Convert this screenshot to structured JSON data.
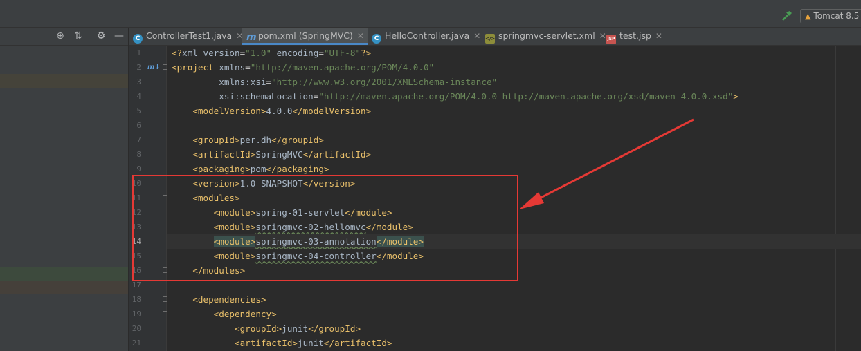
{
  "toolbar": {
    "build_icon": "hammer-icon",
    "run_config_label": "Tomcat 8.5"
  },
  "left_panel": {
    "icons": [
      "crosshair-icon",
      "collapse-icon",
      "gear-icon",
      "minimize-icon"
    ]
  },
  "tabs": [
    {
      "label": "ControllerTest1.java",
      "icon": "class-icon",
      "active": false
    },
    {
      "label": "pom.xml (SpringMVC)",
      "icon": "maven-icon",
      "active": true
    },
    {
      "label": "HelloController.java",
      "icon": "class-icon",
      "active": false
    },
    {
      "label": "springmvc-servlet.xml",
      "icon": "xml-icon",
      "active": false
    },
    {
      "label": "test.jsp",
      "icon": "jsp-icon",
      "active": false
    }
  ],
  "editor": {
    "current_line": 14,
    "lines": [
      {
        "n": "1",
        "text": "<?xml version=\"1.0\" encoding=\"UTF-8\"?>"
      },
      {
        "n": "2",
        "text": "<project xmlns=\"http://maven.apache.org/POM/4.0.0\""
      },
      {
        "n": "3",
        "text": "         xmlns:xsi=\"http://www.w3.org/2001/XMLSchema-instance\""
      },
      {
        "n": "4",
        "text": "         xsi:schemaLocation=\"http://maven.apache.org/POM/4.0.0 http://maven.apache.org/xsd/maven-4.0.0.xsd\">"
      },
      {
        "n": "5",
        "text": "    <modelVersion>4.0.0</modelVersion>"
      },
      {
        "n": "6",
        "text": ""
      },
      {
        "n": "7",
        "text": "    <groupId>per.dh</groupId>"
      },
      {
        "n": "8",
        "text": "    <artifactId>SpringMVC</artifactId>"
      },
      {
        "n": "9",
        "text": "    <packaging>pom</packaging>"
      },
      {
        "n": "10",
        "text": "    <version>1.0-SNAPSHOT</version>"
      },
      {
        "n": "11",
        "text": "    <modules>"
      },
      {
        "n": "12",
        "text": "        <module>spring-01-servlet</module>"
      },
      {
        "n": "13",
        "text": "        <module>springmvc-02-hellomvc</module>"
      },
      {
        "n": "14",
        "text": "        <module>springmvc-03-annotation</module>"
      },
      {
        "n": "15",
        "text": "        <module>springmvc-04-controller</module>"
      },
      {
        "n": "16",
        "text": "    </modules>"
      },
      {
        "n": "17",
        "text": ""
      },
      {
        "n": "18",
        "text": "    <dependencies>"
      },
      {
        "n": "19",
        "text": "        <dependency>"
      },
      {
        "n": "20",
        "text": "            <groupId>junit</groupId>"
      },
      {
        "n": "21",
        "text": "            <artifactId>junit</artifactId>"
      }
    ]
  },
  "annotation": {
    "box_color": "#e53935",
    "arrow_color": "#e53935"
  }
}
